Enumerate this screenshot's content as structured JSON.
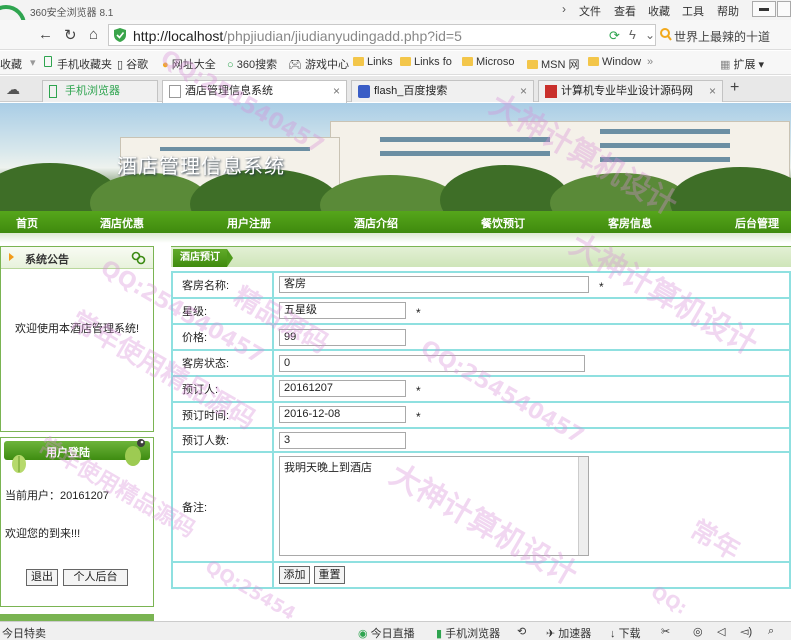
{
  "browser": {
    "app_title": "360安全浏览器 8.1",
    "menu": [
      "文件",
      "查看",
      "收藏",
      "工具",
      "帮助"
    ],
    "url_host": "http://localhost",
    "url_path": "/phpjiudian/jiudianyudingadd.php?id=5",
    "search_text": "世界上最辣的十道",
    "bookmarks": [
      "收藏",
      "手机收藏夹",
      "谷歌",
      "网址大全",
      "360搜索",
      "游戏中心",
      "Links",
      "Links fo",
      "Microso",
      "MSN 网",
      "Window",
      "扩展"
    ],
    "tabs": [
      {
        "label": "手机浏览器",
        "active": false
      },
      {
        "label": "酒店管理信息系统",
        "active": true
      },
      {
        "label": "flash_百度搜索",
        "active": false
      },
      {
        "label": "计算机专业毕业设计源码网",
        "active": false
      }
    ],
    "new_tab": "+",
    "status": {
      "left": "今日特卖",
      "items": [
        "今日直播",
        "手机浏览器",
        "加速器",
        "下载"
      ]
    }
  },
  "site": {
    "title": "酒店管理信息系统",
    "nav": [
      "首页",
      "酒店优惠",
      "用户注册",
      "酒店介绍",
      "餐饮预订",
      "客房信息",
      "后台管理"
    ]
  },
  "notice": {
    "title": "系统公告",
    "text": "欢迎使用本酒店管理系统!"
  },
  "login": {
    "title": "用户登陆",
    "current_user": "当前用户：20161207",
    "welcome": "欢迎您的到来!!!",
    "logout": "退出",
    "personal": "个人后台"
  },
  "booking": {
    "tab": "酒店预订",
    "fields": {
      "room_name": {
        "label": "客房名称:",
        "value": "客房",
        "required": "*"
      },
      "star": {
        "label": "星级:",
        "value": "五星级",
        "required": "*"
      },
      "price": {
        "label": "价格:",
        "value": "99"
      },
      "room_status": {
        "label": "客房状态:",
        "value": "0"
      },
      "booker": {
        "label": "预订人:",
        "value": "20161207",
        "required": "*"
      },
      "booking_time": {
        "label": "预订时间:",
        "value": "2016-12-08",
        "required": "*"
      },
      "guests": {
        "label": "预订人数:",
        "value": "3"
      },
      "remark": {
        "label": "备注:",
        "value": "我明天晚上到酒店"
      }
    },
    "submit": "添加",
    "reset": "重置"
  },
  "watermarks": [
    "常年使用精品源码",
    "QQ:254540457",
    "大神计算机设计",
    "精品源码",
    "常年",
    "QQ:254540457",
    "大神计算机设计",
    "常年使用精品源码",
    "QQ:254540457",
    "大神计算机设计",
    "QQ:25454",
    "QQ:"
  ]
}
